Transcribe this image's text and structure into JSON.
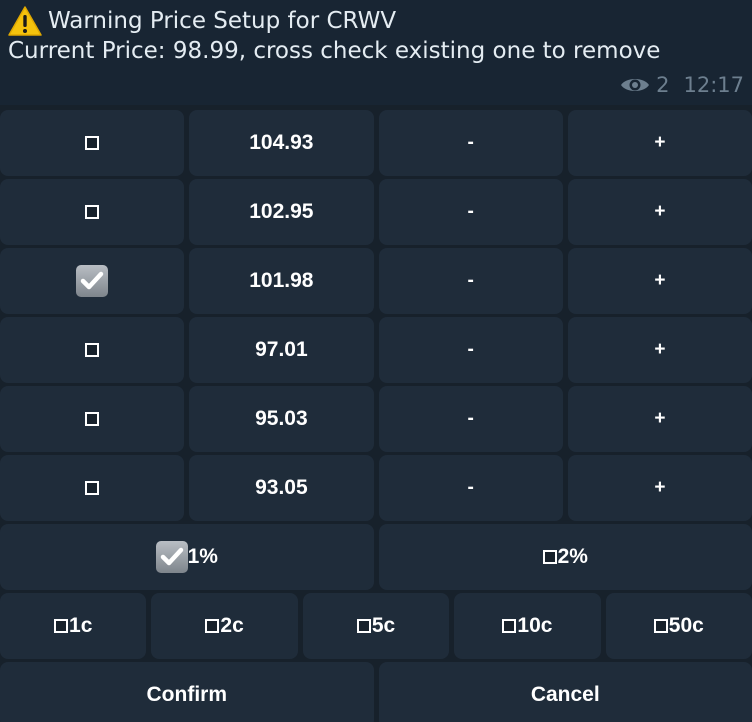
{
  "message": {
    "title": "Warning Price Setup for CRWV",
    "subtitle": "Current Price: 98.99, cross check existing one to remove",
    "views": "2",
    "time": "12:17",
    "icons": {
      "warning": "warning-triangle-icon",
      "views": "eye-icon"
    }
  },
  "price_rows": [
    {
      "price": "104.93",
      "checked": false,
      "minus": "-",
      "plus": "+"
    },
    {
      "price": "102.95",
      "checked": false,
      "minus": "-",
      "plus": "+"
    },
    {
      "price": "101.98",
      "checked": true,
      "minus": "-",
      "plus": "+"
    },
    {
      "price": "97.01",
      "checked": false,
      "minus": "-",
      "plus": "+"
    },
    {
      "price": "95.03",
      "checked": false,
      "minus": "-",
      "plus": "+"
    },
    {
      "price": "93.05",
      "checked": false,
      "minus": "-",
      "plus": "+"
    }
  ],
  "percent_options": [
    {
      "label": "1%",
      "checked": true
    },
    {
      "label": "2%",
      "checked": false
    }
  ],
  "cent_options": [
    {
      "label": "1c",
      "checked": false
    },
    {
      "label": "2c",
      "checked": false
    },
    {
      "label": "5c",
      "checked": false
    },
    {
      "label": "10c",
      "checked": false
    },
    {
      "label": "50c",
      "checked": false
    }
  ],
  "actions": {
    "confirm": "Confirm",
    "cancel": "Cancel"
  },
  "colors": {
    "background": "#17212b",
    "button": "#1f2c3a",
    "text": "#e4ecf2",
    "meta": "#6d7f8f",
    "warning": "#f4c20d"
  }
}
